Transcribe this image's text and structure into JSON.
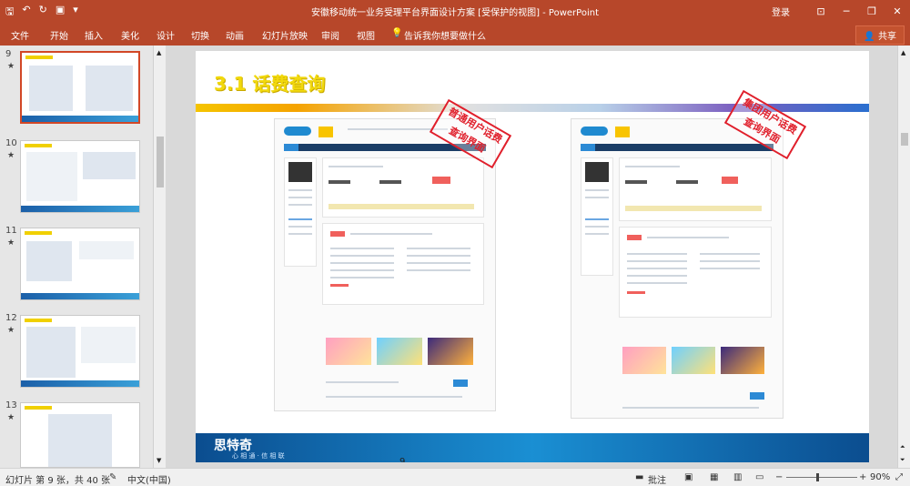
{
  "window": {
    "title": "安徽移动统一业务受理平台界面设计方案 [受保护的视图] - PowerPoint",
    "login": "登录"
  },
  "qat": {
    "save_icon": "save-icon",
    "undo_icon": "undo-icon",
    "redo_icon": "redo-icon",
    "present_icon": "present-icon"
  },
  "ribbon": {
    "tabs": [
      "文件",
      "开始",
      "插入",
      "美化",
      "设计",
      "切换",
      "动画",
      "幻灯片放映",
      "审阅",
      "视图"
    ],
    "tell_me": "告诉我你想要做什么",
    "share": "共享"
  },
  "thumbnails": [
    {
      "num": "9",
      "star": "★"
    },
    {
      "num": "10",
      "star": "★"
    },
    {
      "num": "11",
      "star": "★"
    },
    {
      "num": "12",
      "star": "★"
    },
    {
      "num": "13",
      "star": "★"
    }
  ],
  "slide": {
    "title": "3.1 话费查询",
    "stamp_left": "普通用户话费查询界面",
    "stamp_right": "集团用户话费查询界面",
    "footer_logo": "思特奇",
    "footer_sub": "心 相 通 · 信 相 联",
    "page_number": "9"
  },
  "status": {
    "slide_info": "幻灯片 第 9 张，共 40 张",
    "language": "中文(中国)",
    "notes": "批注",
    "zoom": "90%"
  },
  "colors": {
    "accent": "#b7472a",
    "title_yellow": "#f2d90c",
    "stamp_red": "#e01f2b"
  }
}
